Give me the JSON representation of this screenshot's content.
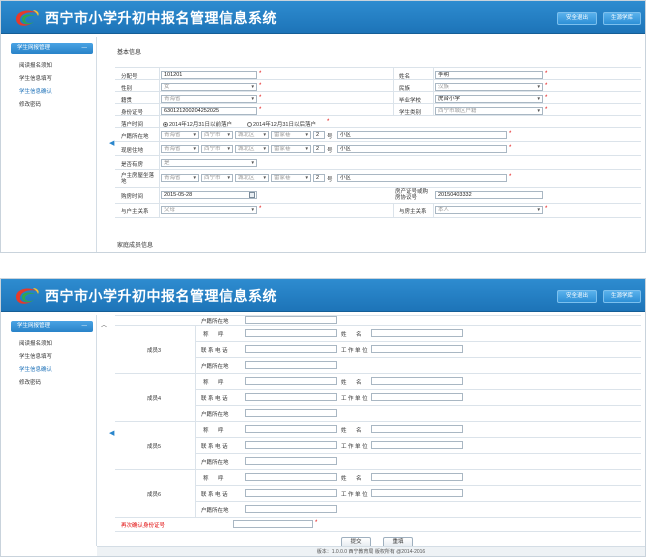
{
  "app_title": "西宁市小学升初中报名管理信息系统",
  "header_buttons": {
    "logout": "安全退出",
    "second": "生源学库"
  },
  "sidebar": {
    "head": "学生网报管理",
    "items": [
      "阅读报名须知",
      "学生信息填写",
      "学生信息确认",
      "修改密码"
    ],
    "active_index": 2
  },
  "form1": {
    "section_basic": "基本信息",
    "section_family": "家庭成员信息",
    "labels": {
      "seq": "分配号",
      "name": "姓名",
      "gender": "性别",
      "ethnicity": "民族",
      "native": "籍贯",
      "school": "毕业学校",
      "idcard": "身份证号",
      "category": "学生类别",
      "settle_time": "落户时间",
      "hukou_addr": "户籍所在地",
      "live_addr": "现居住地",
      "has_house": "是否有房",
      "house_addr": "户主房屋坐落地",
      "buy_time": "购房时间",
      "cert_no": "房产证号或购房协议号",
      "rel_holder": "与户主关系",
      "rel_owner": "与房主关系"
    },
    "values": {
      "seq": "101201",
      "name": "李明",
      "gender": "女",
      "ethnicity": "汉族",
      "native": "青海省",
      "school": "虎台小学",
      "idcard": "630121200204252025",
      "category": "西宁市城区户籍",
      "buy_time": "2015-05-28",
      "cert_no": "20150403332",
      "rel_holder": "父母",
      "rel_owner": "本人",
      "has_house": "是"
    },
    "settle_opt1": "2014年12月31日以前落户",
    "settle_opt2": "2014年12月31日以后落户",
    "addr": {
      "province": "青海省",
      "city": "西宁市",
      "district": "城北区",
      "street": "雷家巷",
      "num": "2",
      "num_unit": "号",
      "community": "小区"
    }
  },
  "form2": {
    "members": [
      "成员3",
      "成员4",
      "成员5",
      "成员6"
    ],
    "labels": {
      "title": "称 呼",
      "name": "姓 名",
      "phone": "联 系 电 话",
      "work": "工 作 单 位",
      "hukou": "户籍所在地"
    },
    "confirm_label": "再次确认身份证号",
    "submit": "提交",
    "reset": "重填"
  },
  "footer": "版本：1.0.0.0 西宁教育局 版权所有 @2014-2016",
  "colors": {
    "header": "#1d74b8",
    "required": "#e00000",
    "link_active": "#1a6fb7"
  }
}
